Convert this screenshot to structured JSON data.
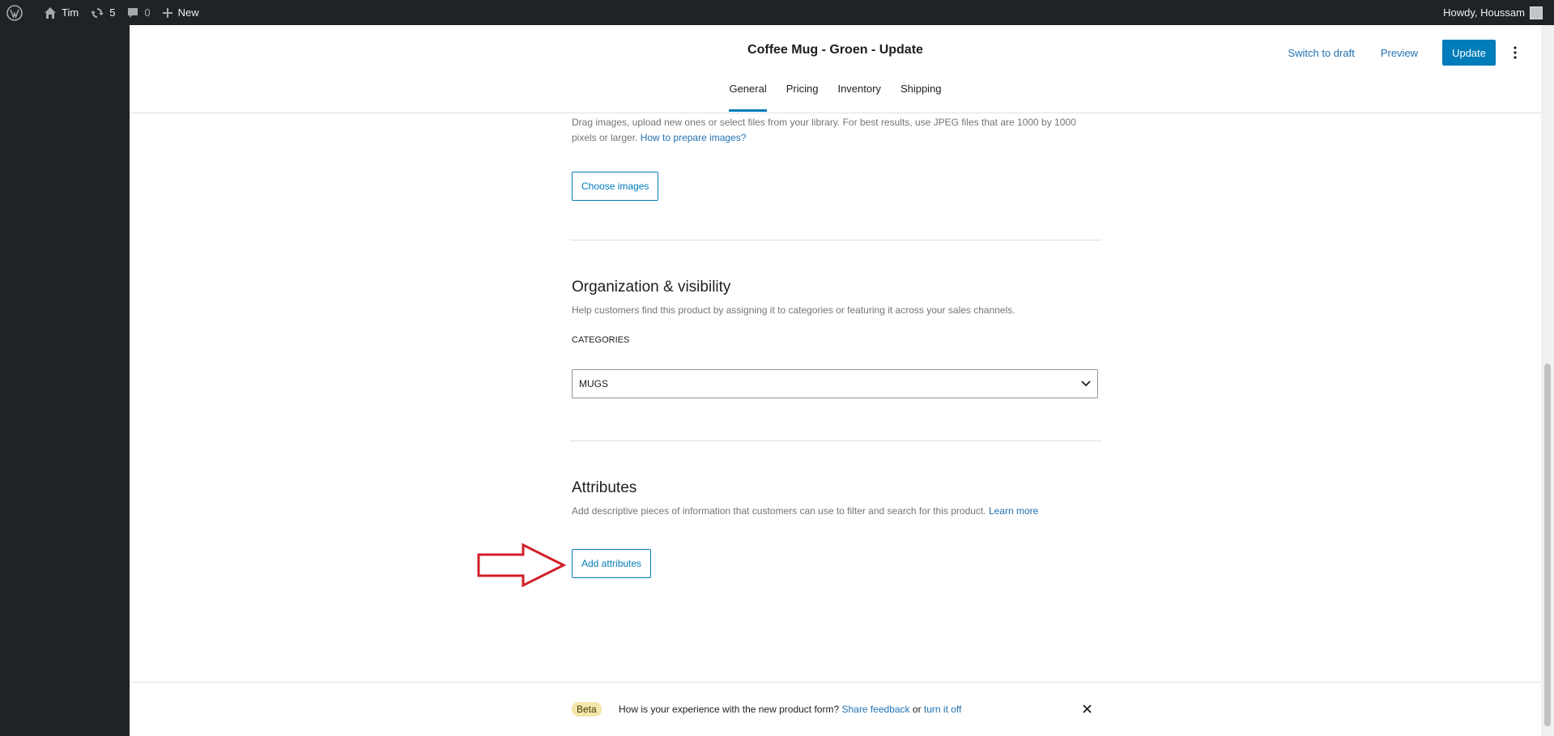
{
  "adminbar": {
    "site_name": "Tim",
    "updates_count": "5",
    "comments_count": "0",
    "new_label": "New",
    "greeting": "Howdy, Houssam"
  },
  "header": {
    "title": "Coffee Mug - Groen - Update",
    "switch_to_draft": "Switch to draft",
    "preview": "Preview",
    "update": "Update",
    "tabs": [
      {
        "label": "General",
        "active": true
      },
      {
        "label": "Pricing",
        "active": false
      },
      {
        "label": "Inventory",
        "active": false
      },
      {
        "label": "Shipping",
        "active": false
      }
    ]
  },
  "images_section": {
    "help_text": "Drag images, upload new ones or select files from your library. For best results, use JPEG files that are 1000 by 1000 pixels or larger.",
    "help_link": "How to prepare images?",
    "choose_button": "Choose images"
  },
  "organization_section": {
    "title": "Organization & visibility",
    "description": "Help customers find this product by assigning it to categories or featuring it across your sales channels.",
    "categories_label": "CATEGORIES",
    "categories_value": "MUGS"
  },
  "attributes_section": {
    "title": "Attributes",
    "description": "Add descriptive pieces of information that customers can use to filter and search for this product.",
    "learn_more": "Learn more",
    "add_button": "Add attributes"
  },
  "footer": {
    "badge": "Beta",
    "question": "How is your experience with the new product form?",
    "share_feedback": "Share feedback",
    "or": "or",
    "turn_off": "turn it off"
  },
  "colors": {
    "accent": "#007cba",
    "annotation_arrow": "#d0202a",
    "admin_bar": "#1d2327"
  },
  "icons": [
    "wordpress-icon",
    "home-icon",
    "updates-icon",
    "comments-icon",
    "plus-icon",
    "more-vertical-icon",
    "chevron-down-icon",
    "close-icon"
  ]
}
